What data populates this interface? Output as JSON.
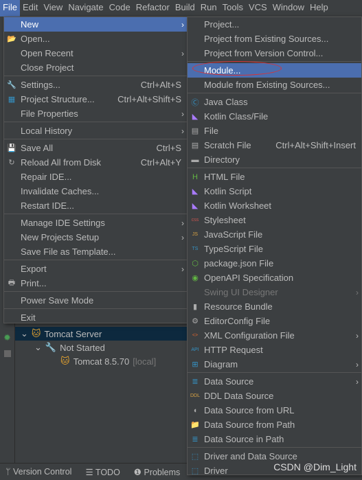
{
  "menubar": [
    "File",
    "Edit",
    "View",
    "Navigate",
    "Code",
    "Refactor",
    "Build",
    "Run",
    "Tools",
    "VCS",
    "Window",
    "Help"
  ],
  "colors": {
    "highlight": "#4b6eaf",
    "background": "#3c3f41",
    "annotation": "#e03030"
  },
  "file_menu": [
    {
      "label": "New",
      "arrow": true,
      "highlighted": true
    },
    {
      "label": "Open...",
      "icon": "folder-open-icon"
    },
    {
      "label": "Open Recent",
      "arrow": true
    },
    {
      "label": "Close Project"
    },
    {
      "sep": true
    },
    {
      "label": "Settings...",
      "shortcut": "Ctrl+Alt+S",
      "icon": "wrench-icon"
    },
    {
      "label": "Project Structure...",
      "shortcut": "Ctrl+Alt+Shift+S",
      "icon": "project-structure-icon"
    },
    {
      "label": "File Properties",
      "arrow": true
    },
    {
      "sep": true
    },
    {
      "label": "Local History",
      "arrow": true
    },
    {
      "sep": true
    },
    {
      "label": "Save All",
      "shortcut": "Ctrl+S",
      "icon": "save-icon"
    },
    {
      "label": "Reload All from Disk",
      "shortcut": "Ctrl+Alt+Y",
      "icon": "reload-icon"
    },
    {
      "label": "Repair IDE..."
    },
    {
      "label": "Invalidate Caches..."
    },
    {
      "label": "Restart IDE..."
    },
    {
      "sep": true
    },
    {
      "label": "Manage IDE Settings",
      "arrow": true
    },
    {
      "label": "New Projects Setup",
      "arrow": true
    },
    {
      "label": "Save File as Template..."
    },
    {
      "sep": true
    },
    {
      "label": "Export",
      "arrow": true
    },
    {
      "label": "Print...",
      "icon": "print-icon"
    },
    {
      "sep": true
    },
    {
      "label": "Power Save Mode"
    },
    {
      "sep": true
    },
    {
      "label": "Exit"
    }
  ],
  "new_menu": [
    {
      "label": "Project..."
    },
    {
      "label": "Project from Existing Sources..."
    },
    {
      "label": "Project from Version Control..."
    },
    {
      "sep": true
    },
    {
      "label": "Module...",
      "highlighted": true
    },
    {
      "label": "Module from Existing Sources..."
    },
    {
      "sep": true
    },
    {
      "label": "Java Class",
      "icon": "java-class-icon"
    },
    {
      "label": "Kotlin Class/File",
      "icon": "kotlin-file-icon"
    },
    {
      "label": "File",
      "icon": "file-icon"
    },
    {
      "label": "Scratch File",
      "shortcut": "Ctrl+Alt+Shift+Insert",
      "icon": "scratch-file-icon"
    },
    {
      "label": "Directory",
      "icon": "directory-icon"
    },
    {
      "sep": true
    },
    {
      "label": "HTML File",
      "icon": "html-file-icon"
    },
    {
      "label": "Kotlin Script",
      "icon": "kotlin-script-icon"
    },
    {
      "label": "Kotlin Worksheet",
      "icon": "kotlin-worksheet-icon"
    },
    {
      "label": "Stylesheet",
      "icon": "css-file-icon"
    },
    {
      "label": "JavaScript File",
      "icon": "js-file-icon"
    },
    {
      "label": "TypeScript File",
      "icon": "ts-file-icon"
    },
    {
      "label": "package.json File",
      "icon": "nodejs-icon"
    },
    {
      "label": "OpenAPI Specification",
      "icon": "openapi-icon"
    },
    {
      "label": "Swing UI Designer",
      "arrow": true,
      "disabled": true
    },
    {
      "label": "Resource Bundle",
      "icon": "resource-bundle-icon"
    },
    {
      "label": "EditorConfig File",
      "icon": "gear-icon"
    },
    {
      "label": "XML Configuration File",
      "arrow": true,
      "icon": "xml-file-icon"
    },
    {
      "label": "HTTP Request",
      "icon": "api-icon"
    },
    {
      "label": "Diagram",
      "arrow": true,
      "icon": "diagram-icon"
    },
    {
      "sep": true
    },
    {
      "label": "Data Source",
      "arrow": true,
      "icon": "database-icon"
    },
    {
      "label": "DDL Data Source",
      "icon": "ddl-icon"
    },
    {
      "label": "Data Source from URL",
      "icon": "plug-icon"
    },
    {
      "label": "Data Source from Path",
      "icon": "folder-icon"
    },
    {
      "label": "Data Source in Path",
      "icon": "database-icon"
    },
    {
      "sep": true
    },
    {
      "label": "Driver and Data Source",
      "icon": "driver-icon"
    },
    {
      "label": "Driver",
      "icon": "driver-icon"
    }
  ],
  "tree": {
    "server": "Tomcat Server",
    "status": "Not Started",
    "instance": "Tomcat 8.5.70",
    "instance_tag": "[local]"
  },
  "statusbar": {
    "version_control": "Version Control",
    "todo": "TODO",
    "problems": "Problems"
  },
  "watermark": "CSDN @Dim_Light"
}
